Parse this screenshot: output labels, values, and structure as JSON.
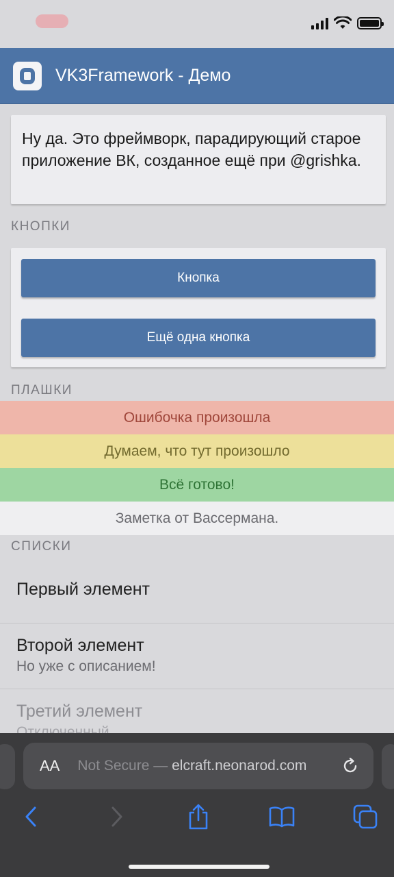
{
  "header": {
    "title": "VK3Framework - Демо"
  },
  "intro": {
    "text": "Ну да. Это фреймворк, парадирующий старое приложение ВК, созданное ещё при @grishka."
  },
  "sections": {
    "buttons_label": "КНОПКИ",
    "plates_label": "ПЛАШКИ",
    "lists_label": "СПИСКИ"
  },
  "buttons": [
    {
      "label": "Кнопка"
    },
    {
      "label": "Ещё одна кнопка"
    }
  ],
  "plates": {
    "error": "Ошибочка произошла",
    "warning": "Думаем, что тут произошло",
    "success": "Всё готово!",
    "note": "Заметка от Вассермана."
  },
  "list": [
    {
      "title": "Первый элемент"
    },
    {
      "title": "Второй элемент",
      "description": "Но уже с описанием!"
    },
    {
      "title": "Третий элемент",
      "description": "Отключенный",
      "disabled": true
    }
  ],
  "browser": {
    "aa_label": "AA",
    "url_prefix": "Not Secure —",
    "url_host": "elcraft.neonarod.com"
  },
  "colors": {
    "accent": "#4d74a6",
    "error_bg": "#efb6aa",
    "warning_bg": "#ede09a",
    "success_bg": "#9ed6a2",
    "note_bg": "#efeff1",
    "browser_icon": "#3a82f7"
  }
}
